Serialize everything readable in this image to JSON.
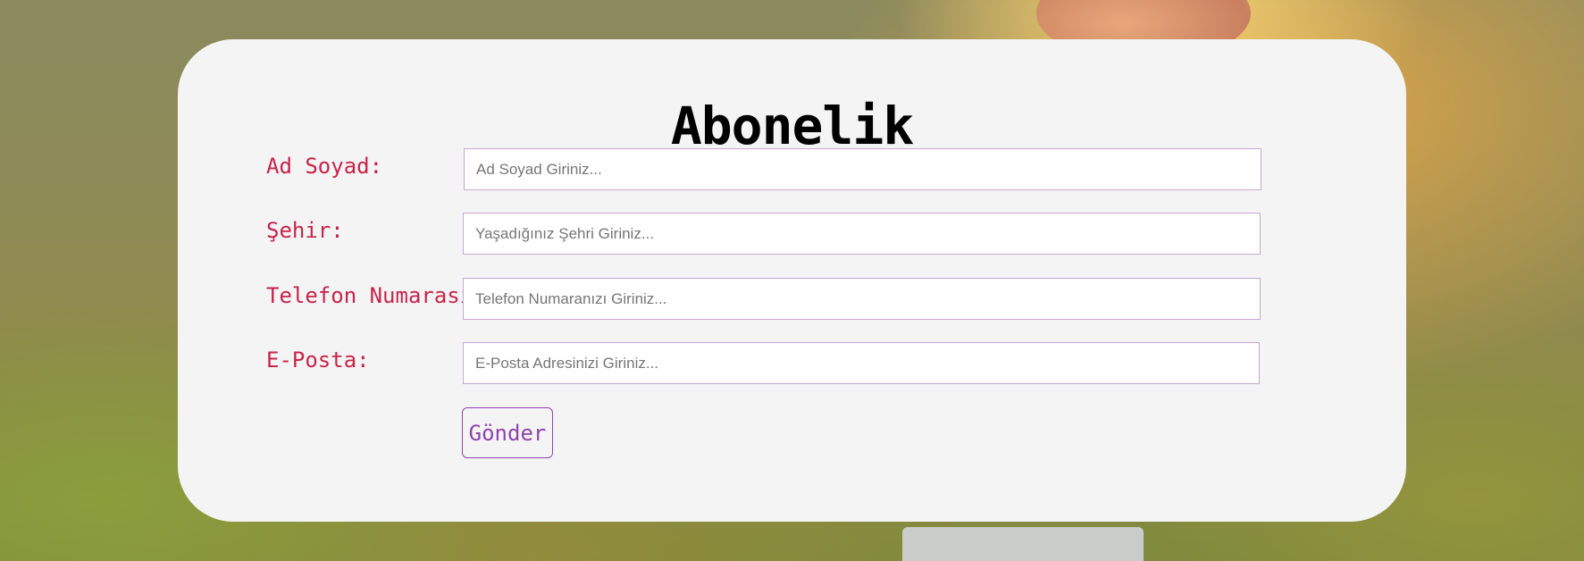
{
  "form": {
    "title": "Abonelik",
    "fields": [
      {
        "label": "Ad Soyad:",
        "placeholder": "Ad Soyad Giriniz...",
        "value": ""
      },
      {
        "label": "Şehir:",
        "placeholder": "Yaşadığınız Şehri Giriniz...",
        "value": ""
      },
      {
        "label": "Telefon Numarası:",
        "placeholder": "Telefon Numaranızı Giriniz...",
        "value": ""
      },
      {
        "label": "E-Posta:",
        "placeholder": "E-Posta Adresinizi Giriniz...",
        "value": ""
      }
    ],
    "submit_label": "Gönder"
  },
  "colors": {
    "label": "#c8244a",
    "accent": "#8e44ad",
    "input_border": "#c9a6d6",
    "card_background": "#f4f4f4"
  }
}
